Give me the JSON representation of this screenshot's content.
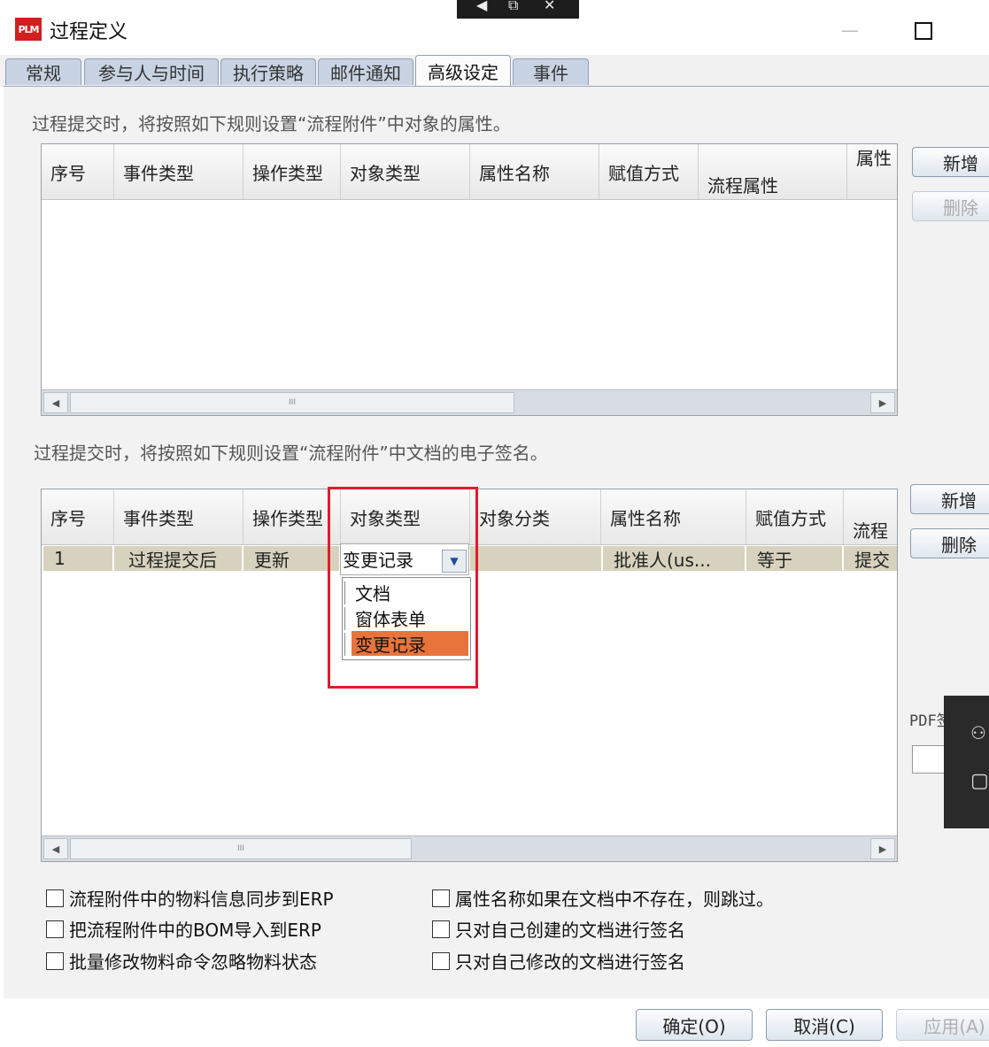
{
  "window": {
    "logo_text": "PLM",
    "title": "过程定义",
    "minimize_glyph": "—",
    "maximize_glyph": "",
    "remote_bar_icons": [
      "◀",
      "⧉",
      "✕"
    ]
  },
  "tabs": [
    {
      "label": "常规",
      "active": false
    },
    {
      "label": "参与人与时间",
      "active": false
    },
    {
      "label": "执行策略",
      "active": false
    },
    {
      "label": "邮件通知",
      "active": false
    },
    {
      "label": "高级设定",
      "active": true
    },
    {
      "label": "事件",
      "active": false
    }
  ],
  "section1": {
    "label": "过程提交时，将按照如下规则设置“流程附件”中对象的属性。",
    "columns": [
      "序号",
      "事件类型",
      "操作类型",
      "对象类型",
      "属性名称",
      "赋值方式",
      "流程属性",
      "属性"
    ],
    "rows": [],
    "add_button": "新增",
    "delete_button": "删除"
  },
  "section2": {
    "label": "过程提交时，将按照如下规则设置“流程附件”中文档的电子签名。",
    "columns": [
      "序号",
      "事件类型",
      "操作类型",
      "对象类型",
      "对象分类",
      "属性名称",
      "赋值方式",
      "流程"
    ],
    "rows": [
      {
        "seq": "1",
        "event_type": "过程提交后",
        "op_type": "更新",
        "object_type": "变更记录",
        "object_category": "",
        "attr_name": "批准人(us...",
        "assign_mode": "等于",
        "flow": "提交"
      }
    ],
    "add_button": "新增",
    "delete_button": "删除",
    "combo_value": "变更记录",
    "dropdown_options": [
      {
        "label": "文档",
        "selected": false
      },
      {
        "label": "窗体表单",
        "selected": false
      },
      {
        "label": "变更记录",
        "selected": true
      }
    ],
    "pdf_label": "PDF签"
  },
  "checkboxes_left": [
    {
      "label": "流程附件中的物料信息同步到ERP",
      "checked": false
    },
    {
      "label": "把流程附件中的BOM导入到ERP",
      "checked": false
    },
    {
      "label": "批量修改物料命令忽略物料状态",
      "checked": false
    }
  ],
  "checkboxes_right": [
    {
      "label": "属性名称如果在文档中不存在，则跳过。",
      "checked": false
    },
    {
      "label": "只对自己创建的文档进行签名",
      "checked": false
    },
    {
      "label": "只对自己修改的文档进行签名",
      "checked": false
    }
  ],
  "footer": {
    "ok": "确定(O)",
    "cancel": "取消(C)",
    "apply": "应用(A)"
  },
  "scroll_glyphs": {
    "left": "◀",
    "right": "▶",
    "grip": "III"
  }
}
